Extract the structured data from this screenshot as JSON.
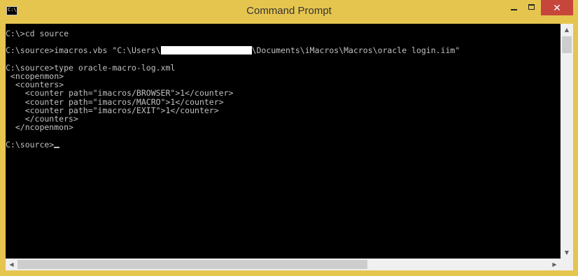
{
  "window": {
    "title": "Command Prompt",
    "icon": "cmd-icon",
    "icon_glyph": "C:\\",
    "controls": {
      "minimize": "minimize-icon",
      "maximize": "maximize-icon",
      "close_label": "✕"
    }
  },
  "console": {
    "line1": "C:\\>cd source",
    "line2_prefix": "C:\\source>imacros.vbs \"C:\\Users\\",
    "line2_suffix": "\\Documents\\iMacros\\Macros\\oracle login.iim\"",
    "line3": "C:\\source>type oracle-macro-log.xml",
    "xml": [
      " <ncopenmon>",
      "  <counters>",
      "    <counter path=\"imacros/BROWSER\">1</counter>",
      "    <counter path=\"imacros/MACRO\">1</counter>",
      "    <counter path=\"imacros/EXIT\">1</counter>",
      "    </counters>",
      "  </ncopenmon>"
    ],
    "prompt": "C:\\source>"
  },
  "scrollbars": {
    "up_arrow": "▲",
    "down_arrow": "▼",
    "left_arrow": "◀",
    "right_arrow": "▶"
  },
  "colors": {
    "background": "#000000",
    "text": "#c0c0c0",
    "frame": "#e6c54f",
    "close_button": "#c7463c"
  }
}
